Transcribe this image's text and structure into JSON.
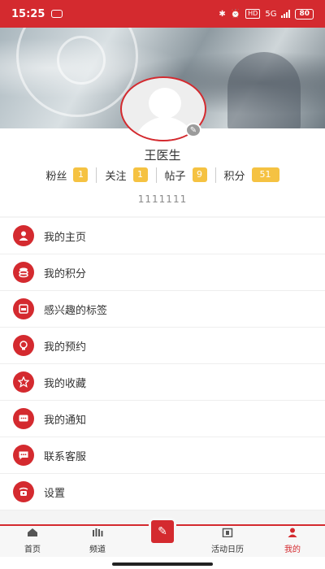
{
  "status_bar": {
    "time": "15:25",
    "network": "5G",
    "hd": "HD",
    "battery": "80"
  },
  "user": {
    "name": "王医生",
    "id": "1111111"
  },
  "stats": [
    {
      "label": "粉丝",
      "value": "1"
    },
    {
      "label": "关注",
      "value": "1"
    },
    {
      "label": "帖子",
      "value": "9"
    },
    {
      "label": "积分",
      "value": "51"
    }
  ],
  "menu": [
    {
      "label": "我的主页",
      "icon": "person-icon"
    },
    {
      "label": "我的积分",
      "icon": "coins-icon"
    },
    {
      "label": "感兴趣的标签",
      "icon": "tag-icon"
    },
    {
      "label": "我的预约",
      "icon": "lightbulb-icon"
    },
    {
      "label": "我的收藏",
      "icon": "star-icon"
    },
    {
      "label": "我的通知",
      "icon": "message-icon"
    },
    {
      "label": "联系客服",
      "icon": "chat-icon"
    },
    {
      "label": "设置",
      "icon": "settings-icon"
    }
  ],
  "bottom_nav": {
    "home": "首页",
    "channel": "频道",
    "calendar": "活动日历",
    "mine": "我的"
  },
  "colors": {
    "accent": "#d42a2f",
    "badge": "#f5c242"
  }
}
